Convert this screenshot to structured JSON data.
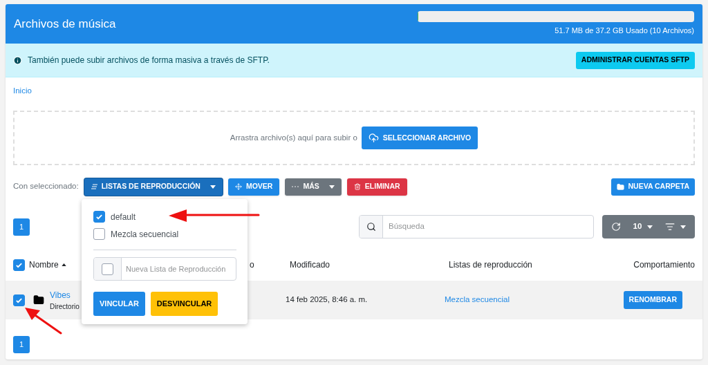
{
  "header": {
    "title": "Archivos de música",
    "storage": {
      "level": 0.0014,
      "reading": "51.7 MB de 37.2 GB Usado (10 Archivos)"
    }
  },
  "notice": {
    "text": "También puede subir archivos de forma masiva a través de SFTP.",
    "button": "ADMINISTRAR CUENTAS SFTP"
  },
  "breadcrumb": [
    "Inicio"
  ],
  "dropzone": {
    "text": "Arrastra archivo(s) aquí para subir o",
    "button": "SELECCIONAR ARCHIVO"
  },
  "toolbar": {
    "label": "Con seleccionado:",
    "buttons": [
      {
        "kind": "playlists",
        "label": "LISTAS DE REPRODUCCIÓN",
        "expanded": true
      },
      {
        "kind": "move",
        "label": "MOVER",
        "expanded": false
      },
      {
        "kind": "more",
        "label": "MÁS",
        "expanded": false
      },
      {
        "kind": "delete",
        "label": "ELIMINAR",
        "expanded": false
      }
    ],
    "new_folder": "NUEVA CARPETA"
  },
  "playlist_menu": {
    "items": [
      {
        "label": "default",
        "checked": true
      },
      {
        "label": "Mezcla secuencial",
        "checked": false
      }
    ],
    "new_playlist": {
      "checked": false,
      "placeholder": "Nueva Lista de Reproducción"
    },
    "buttons": [
      {
        "kind": "link",
        "label": "VINCULAR"
      },
      {
        "kind": "unlink",
        "label": "DESVINCULAR"
      }
    ]
  },
  "pagination_top": [
    {
      "label": "1",
      "selected": true
    }
  ],
  "search": {
    "placeholder": "Búsqueda"
  },
  "table_tools": {
    "page_size": "10"
  },
  "table": {
    "all_checked": true,
    "columns": [
      {
        "label": "Nombre",
        "sorted": true
      },
      {
        "label": "o",
        "sorted": false
      },
      {
        "label": "Modificado",
        "sorted": false
      },
      {
        "label": "Listas de reproducción",
        "sorted": false
      },
      {
        "label": "Comportamiento",
        "sorted": false
      }
    ],
    "rows": [
      {
        "checked": true,
        "name": "Vibes",
        "type": "Directorio",
        "modified": "14 feb 2025, 8:46 a. m.",
        "playlists": "Mezcla secuencial",
        "action": "RENOMBRAR"
      }
    ]
  },
  "pagination_bottom": [
    {
      "label": "1",
      "selected": true
    }
  ]
}
